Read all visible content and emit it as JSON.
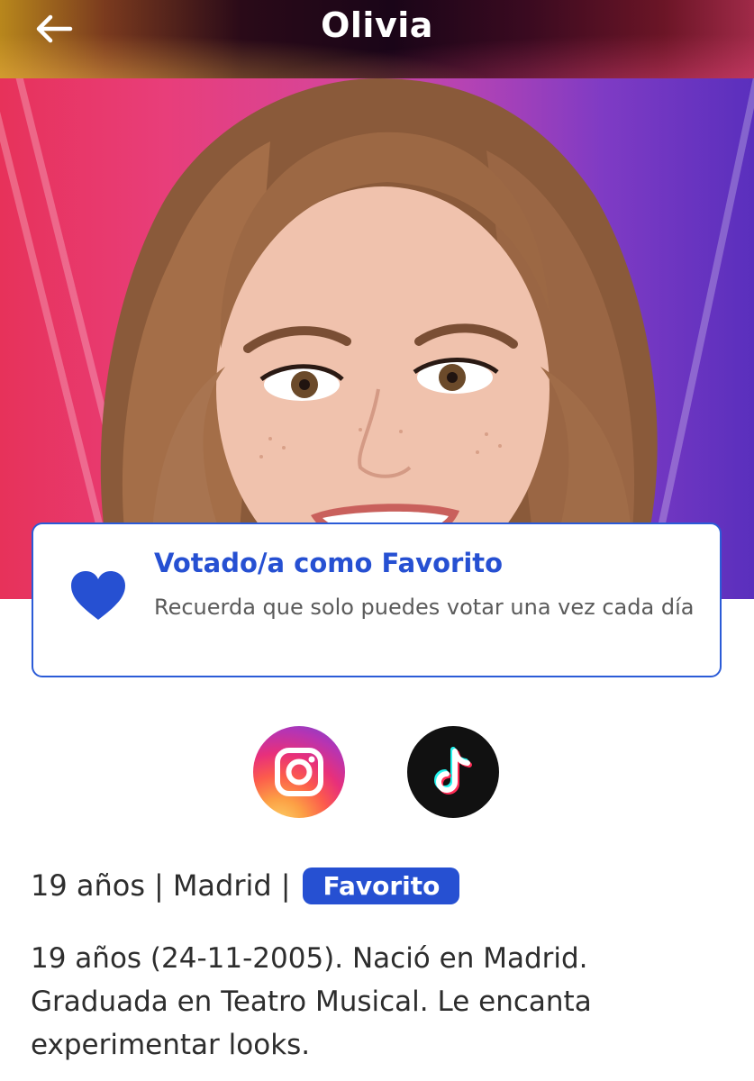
{
  "header": {
    "title": "Olivia",
    "back_icon": "arrow-left-icon"
  },
  "hero": {
    "icon": "portrait-photo"
  },
  "vote_card": {
    "title": "Votado/a como Favorito",
    "message": "Recuerda que solo puedes votar una vez cada día",
    "icon": "heart-icon",
    "accent_color": "#2650d2"
  },
  "social": {
    "instagram_icon": "instagram-icon",
    "tiktok_icon": "tiktok-icon"
  },
  "info": {
    "age": "19 años",
    "separator": "|",
    "city": "Madrid",
    "badge": "Favorito",
    "bio": "19 años (24-11-2005).  Nació en Madrid. Graduada en Teatro Musical. Le encanta experimentar looks."
  }
}
